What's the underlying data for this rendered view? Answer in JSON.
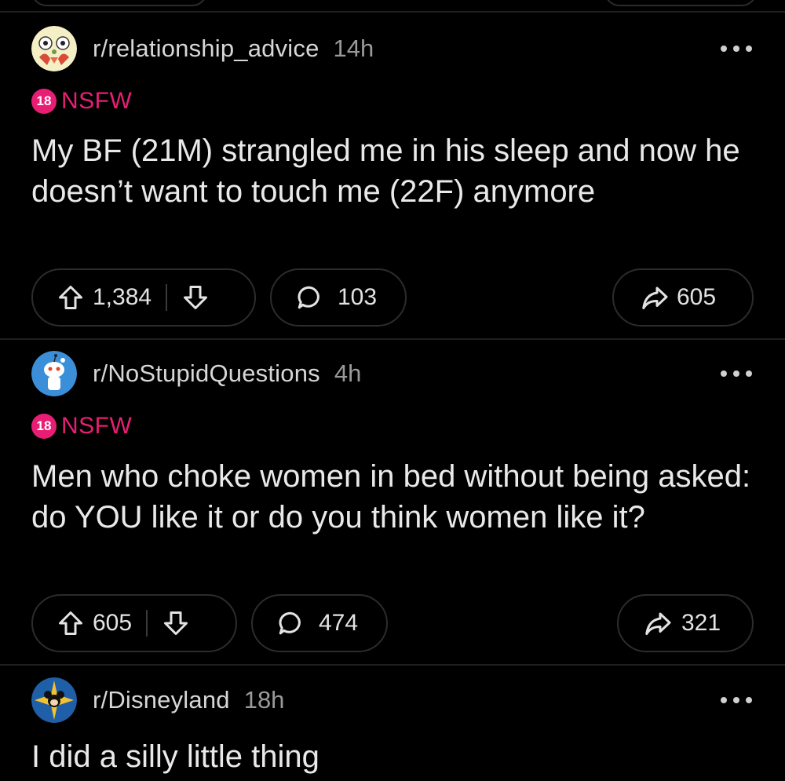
{
  "posts": [
    {
      "subreddit": "r/relationship_advice",
      "age": "14h",
      "nsfw_number": "18",
      "nsfw_label": "NSFW",
      "title": "My BF (21M) strangled me in his sleep and now he doesn’t want to touch me (22F) anymore",
      "upvotes": "1,384",
      "comments": "103",
      "shares": "605"
    },
    {
      "subreddit": "r/NoStupidQuestions",
      "age": "4h",
      "nsfw_number": "18",
      "nsfw_label": "NSFW",
      "title": "Men who choke women in bed without being asked: do YOU like it or do you think women like it?",
      "upvotes": "605",
      "comments": "474",
      "shares": "321"
    },
    {
      "subreddit": "r/Disneyland",
      "age": "18h",
      "title": "I did a silly little thing"
    }
  ],
  "colors": {
    "background": "#000000",
    "nsfw": "#e81e74",
    "border": "#2c2c2c"
  },
  "icons": [
    "upvote-arrow-icon",
    "downvote-arrow-icon",
    "comment-bubble-icon",
    "share-arrow-icon",
    "more-options-icon"
  ]
}
